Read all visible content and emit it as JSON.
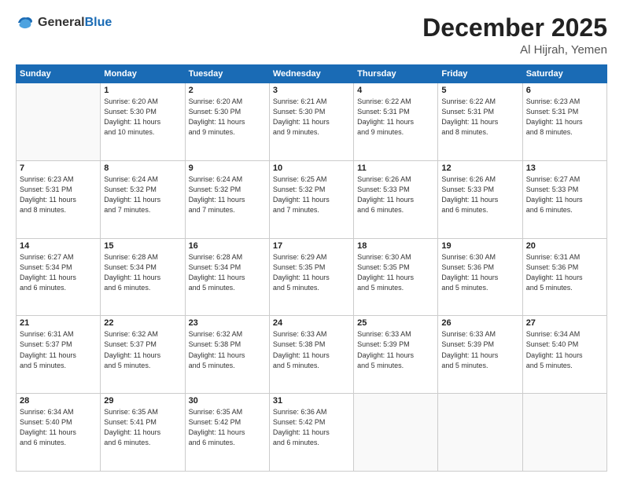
{
  "header": {
    "logo_general": "General",
    "logo_blue": "Blue",
    "month": "December 2025",
    "location": "Al Hijrah, Yemen"
  },
  "days_of_week": [
    "Sunday",
    "Monday",
    "Tuesday",
    "Wednesday",
    "Thursday",
    "Friday",
    "Saturday"
  ],
  "weeks": [
    [
      {
        "day": "",
        "info": ""
      },
      {
        "day": "1",
        "info": "Sunrise: 6:20 AM\nSunset: 5:30 PM\nDaylight: 11 hours\nand 10 minutes."
      },
      {
        "day": "2",
        "info": "Sunrise: 6:20 AM\nSunset: 5:30 PM\nDaylight: 11 hours\nand 9 minutes."
      },
      {
        "day": "3",
        "info": "Sunrise: 6:21 AM\nSunset: 5:30 PM\nDaylight: 11 hours\nand 9 minutes."
      },
      {
        "day": "4",
        "info": "Sunrise: 6:22 AM\nSunset: 5:31 PM\nDaylight: 11 hours\nand 9 minutes."
      },
      {
        "day": "5",
        "info": "Sunrise: 6:22 AM\nSunset: 5:31 PM\nDaylight: 11 hours\nand 8 minutes."
      },
      {
        "day": "6",
        "info": "Sunrise: 6:23 AM\nSunset: 5:31 PM\nDaylight: 11 hours\nand 8 minutes."
      }
    ],
    [
      {
        "day": "7",
        "info": "Sunrise: 6:23 AM\nSunset: 5:31 PM\nDaylight: 11 hours\nand 8 minutes."
      },
      {
        "day": "8",
        "info": "Sunrise: 6:24 AM\nSunset: 5:32 PM\nDaylight: 11 hours\nand 7 minutes."
      },
      {
        "day": "9",
        "info": "Sunrise: 6:24 AM\nSunset: 5:32 PM\nDaylight: 11 hours\nand 7 minutes."
      },
      {
        "day": "10",
        "info": "Sunrise: 6:25 AM\nSunset: 5:32 PM\nDaylight: 11 hours\nand 7 minutes."
      },
      {
        "day": "11",
        "info": "Sunrise: 6:26 AM\nSunset: 5:33 PM\nDaylight: 11 hours\nand 6 minutes."
      },
      {
        "day": "12",
        "info": "Sunrise: 6:26 AM\nSunset: 5:33 PM\nDaylight: 11 hours\nand 6 minutes."
      },
      {
        "day": "13",
        "info": "Sunrise: 6:27 AM\nSunset: 5:33 PM\nDaylight: 11 hours\nand 6 minutes."
      }
    ],
    [
      {
        "day": "14",
        "info": "Sunrise: 6:27 AM\nSunset: 5:34 PM\nDaylight: 11 hours\nand 6 minutes."
      },
      {
        "day": "15",
        "info": "Sunrise: 6:28 AM\nSunset: 5:34 PM\nDaylight: 11 hours\nand 6 minutes."
      },
      {
        "day": "16",
        "info": "Sunrise: 6:28 AM\nSunset: 5:34 PM\nDaylight: 11 hours\nand 5 minutes."
      },
      {
        "day": "17",
        "info": "Sunrise: 6:29 AM\nSunset: 5:35 PM\nDaylight: 11 hours\nand 5 minutes."
      },
      {
        "day": "18",
        "info": "Sunrise: 6:30 AM\nSunset: 5:35 PM\nDaylight: 11 hours\nand 5 minutes."
      },
      {
        "day": "19",
        "info": "Sunrise: 6:30 AM\nSunset: 5:36 PM\nDaylight: 11 hours\nand 5 minutes."
      },
      {
        "day": "20",
        "info": "Sunrise: 6:31 AM\nSunset: 5:36 PM\nDaylight: 11 hours\nand 5 minutes."
      }
    ],
    [
      {
        "day": "21",
        "info": "Sunrise: 6:31 AM\nSunset: 5:37 PM\nDaylight: 11 hours\nand 5 minutes."
      },
      {
        "day": "22",
        "info": "Sunrise: 6:32 AM\nSunset: 5:37 PM\nDaylight: 11 hours\nand 5 minutes."
      },
      {
        "day": "23",
        "info": "Sunrise: 6:32 AM\nSunset: 5:38 PM\nDaylight: 11 hours\nand 5 minutes."
      },
      {
        "day": "24",
        "info": "Sunrise: 6:33 AM\nSunset: 5:38 PM\nDaylight: 11 hours\nand 5 minutes."
      },
      {
        "day": "25",
        "info": "Sunrise: 6:33 AM\nSunset: 5:39 PM\nDaylight: 11 hours\nand 5 minutes."
      },
      {
        "day": "26",
        "info": "Sunrise: 6:33 AM\nSunset: 5:39 PM\nDaylight: 11 hours\nand 5 minutes."
      },
      {
        "day": "27",
        "info": "Sunrise: 6:34 AM\nSunset: 5:40 PM\nDaylight: 11 hours\nand 5 minutes."
      }
    ],
    [
      {
        "day": "28",
        "info": "Sunrise: 6:34 AM\nSunset: 5:40 PM\nDaylight: 11 hours\nand 6 minutes."
      },
      {
        "day": "29",
        "info": "Sunrise: 6:35 AM\nSunset: 5:41 PM\nDaylight: 11 hours\nand 6 minutes."
      },
      {
        "day": "30",
        "info": "Sunrise: 6:35 AM\nSunset: 5:42 PM\nDaylight: 11 hours\nand 6 minutes."
      },
      {
        "day": "31",
        "info": "Sunrise: 6:36 AM\nSunset: 5:42 PM\nDaylight: 11 hours\nand 6 minutes."
      },
      {
        "day": "",
        "info": ""
      },
      {
        "day": "",
        "info": ""
      },
      {
        "day": "",
        "info": ""
      }
    ]
  ]
}
